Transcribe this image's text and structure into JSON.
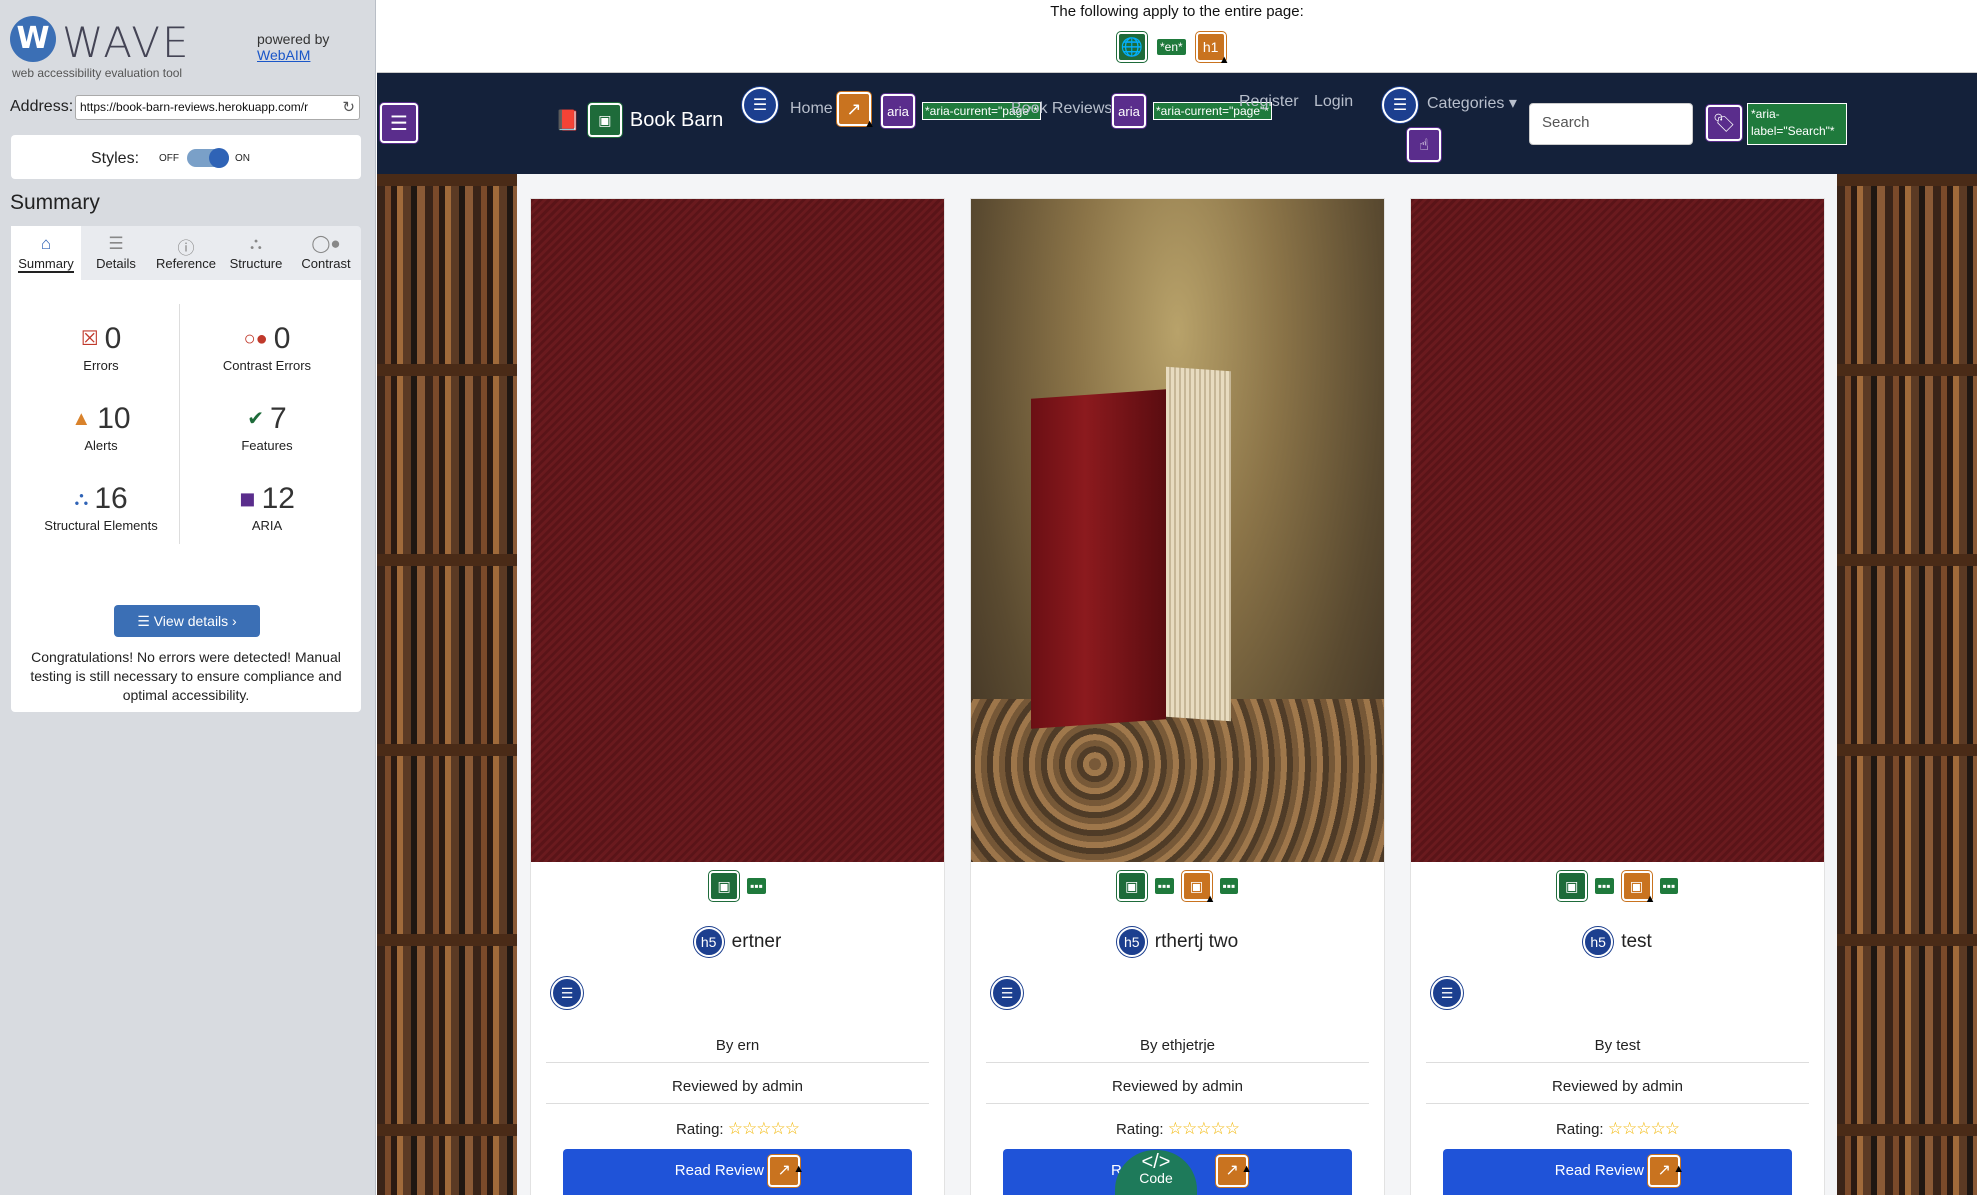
{
  "wave": {
    "logo_letter": "W",
    "title": "WAVE",
    "subtitle": "web accessibility evaluation tool",
    "powered_by": "powered by",
    "webaim_link": "WebAIM",
    "address_label": "Address:",
    "address_value": "https://book-barn-reviews.herokuapp.com/r",
    "styles_label": "Styles:",
    "styles_off": "OFF",
    "styles_on": "ON",
    "summary_heading": "Summary",
    "tabs": [
      {
        "label": "Summary",
        "icon": "home-icon"
      },
      {
        "label": "Details",
        "icon": "list-icon"
      },
      {
        "label": "Reference",
        "icon": "info-icon"
      },
      {
        "label": "Structure",
        "icon": "hierarchy-icon"
      },
      {
        "label": "Contrast",
        "icon": "contrast-icon"
      }
    ],
    "stats": {
      "errors": {
        "count": "0",
        "label": "Errors"
      },
      "contrast": {
        "count": "0",
        "label": "Contrast Errors"
      },
      "alerts": {
        "count": "10",
        "label": "Alerts"
      },
      "features": {
        "count": "7",
        "label": "Features"
      },
      "structural": {
        "count": "16",
        "label": "Structural Elements"
      },
      "aria": {
        "count": "12",
        "label": "ARIA"
      }
    },
    "view_details": "View details ›",
    "congrats": "Congratulations! No errors were detected! Manual testing is still necessary to ensure compliance and optimal accessibility."
  },
  "page": {
    "global_text": "The following apply to the entire page:",
    "lang_tag": "*en*",
    "h1_tag": "h1",
    "brand": "Book Barn",
    "nav": {
      "home": "Home",
      "book_reviews": "Book Reviews",
      "aria": "aria",
      "aria_current": "*aria-current=\"page\"*",
      "register": "Register",
      "login": "Login",
      "categories": "Categories"
    },
    "search_placeholder": "Search",
    "search_aria_label": "*aria-label=\"Search\"*",
    "h5": "h5",
    "cards": [
      {
        "title": "ertner",
        "by": "By ern",
        "reviewed": "Reviewed by admin",
        "rating_label": "Rating:",
        "button": "Read Review"
      },
      {
        "title": "rthertj two",
        "by": "By ethjetrje",
        "reviewed": "Reviewed by admin",
        "rating_label": "Rating:",
        "button": "R"
      },
      {
        "title": "test",
        "by": "By test",
        "reviewed": "Reviewed by admin",
        "rating_label": "Rating:",
        "button": "Read Review"
      }
    ],
    "stars": "☆☆☆☆☆",
    "code_label": "Code"
  },
  "colors": {
    "navbar": "#14213a",
    "wave_blue": "#3b6fb5",
    "read_button": "#1f53d8",
    "feature_green": "#1e6b3a",
    "alert_orange": "#c9731f",
    "aria_purple": "#5a2d8c"
  }
}
